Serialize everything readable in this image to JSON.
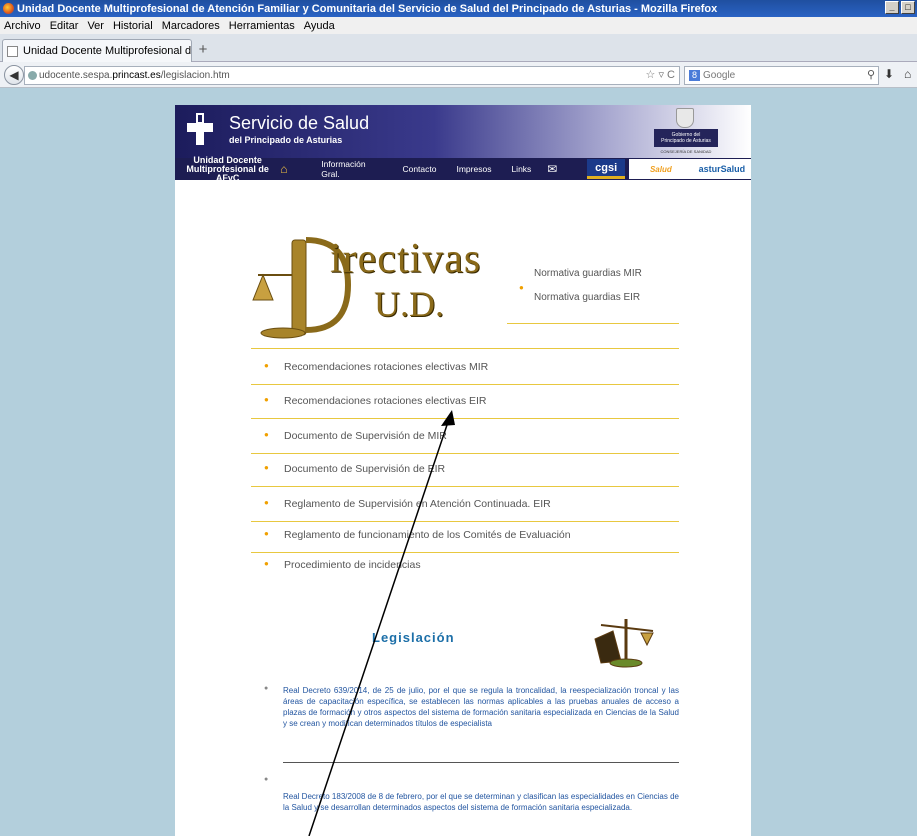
{
  "window": {
    "title": "Unidad Docente Multiprofesional de Atención Familiar y Comunitaria del Servicio de Salud del Principado de Asturias - Mozilla Firefox",
    "controls": [
      "_",
      "□"
    ]
  },
  "menu": [
    "Archivo",
    "Editar",
    "Ver",
    "Historial",
    "Marcadores",
    "Herramientas",
    "Ayuda"
  ],
  "tab": {
    "label": "Unidad Docente Multiprofesional de Atención..."
  },
  "newtab_label": "+",
  "url": {
    "host": "udocente.sespa.",
    "domain": "princast.es",
    "path": "/legislacion.htm"
  },
  "search": {
    "engine_badge": "8",
    "placeholder": "Google"
  },
  "header": {
    "title": "Servicio de Salud",
    "subtitle": "del Principado de Asturias",
    "gov_line1": "Gobierno del",
    "gov_line2": "Principado de Asturias",
    "gov_sub": "CONSEJERÍA DE SANIDAD"
  },
  "nav": {
    "unit_line1": "Unidad Docente",
    "unit_line2": "Multiprofesional de AFyC",
    "links": [
      "Información Gral.",
      "Contacto",
      "Impresos",
      "Links"
    ],
    "cgsi": "cgsi",
    "salud": "Salud",
    "astur": "asturSalud"
  },
  "banner": {
    "title": "irectivas",
    "subtitle": "U.D."
  },
  "side_links": [
    "Normativa guardias MIR",
    "Normativa guardias EIR"
  ],
  "list_items": [
    "Recomendaciones rotaciones electivas MIR",
    "Recomendaciones rotaciones electivas EIR",
    "Documento de Supervisión de MIR",
    "Documento de Supervisión de EIR",
    "Reglamento de Supervisión en Atención Continuada. EIR",
    "Reglamento de funcionamiento de los Comités de Evaluación",
    "Procedimiento de incidencias"
  ],
  "legislacion": {
    "heading": "Legislación",
    "items": [
      "Real Decreto 639/2014, de 25 de julio, por el que se regula la troncalidad, la reespecialización troncal y las áreas de capacitación específica, se establecen las normas aplicables a las pruebas anuales de acceso a plazas de formación y otros aspectos del sistema de formación sanitaria especializada en Ciencias de la Salud y se crean y modifican determinados títulos de especialista",
      "Real Decreto 183/2008 de 8 de febrero, por el que se determinan y clasifican las especialidades en Ciencias de la Salud y se desarrollan determinados aspectos del sistema de formación sanitaria especializada."
    ]
  },
  "colors": {
    "page_bg": "#b3cfdc",
    "header_dark": "#1d1d52",
    "bullet": "#f0a000",
    "rule": "#e8c840",
    "legis_text": "#2255a0",
    "legis_heading": "#1c6fa8"
  }
}
